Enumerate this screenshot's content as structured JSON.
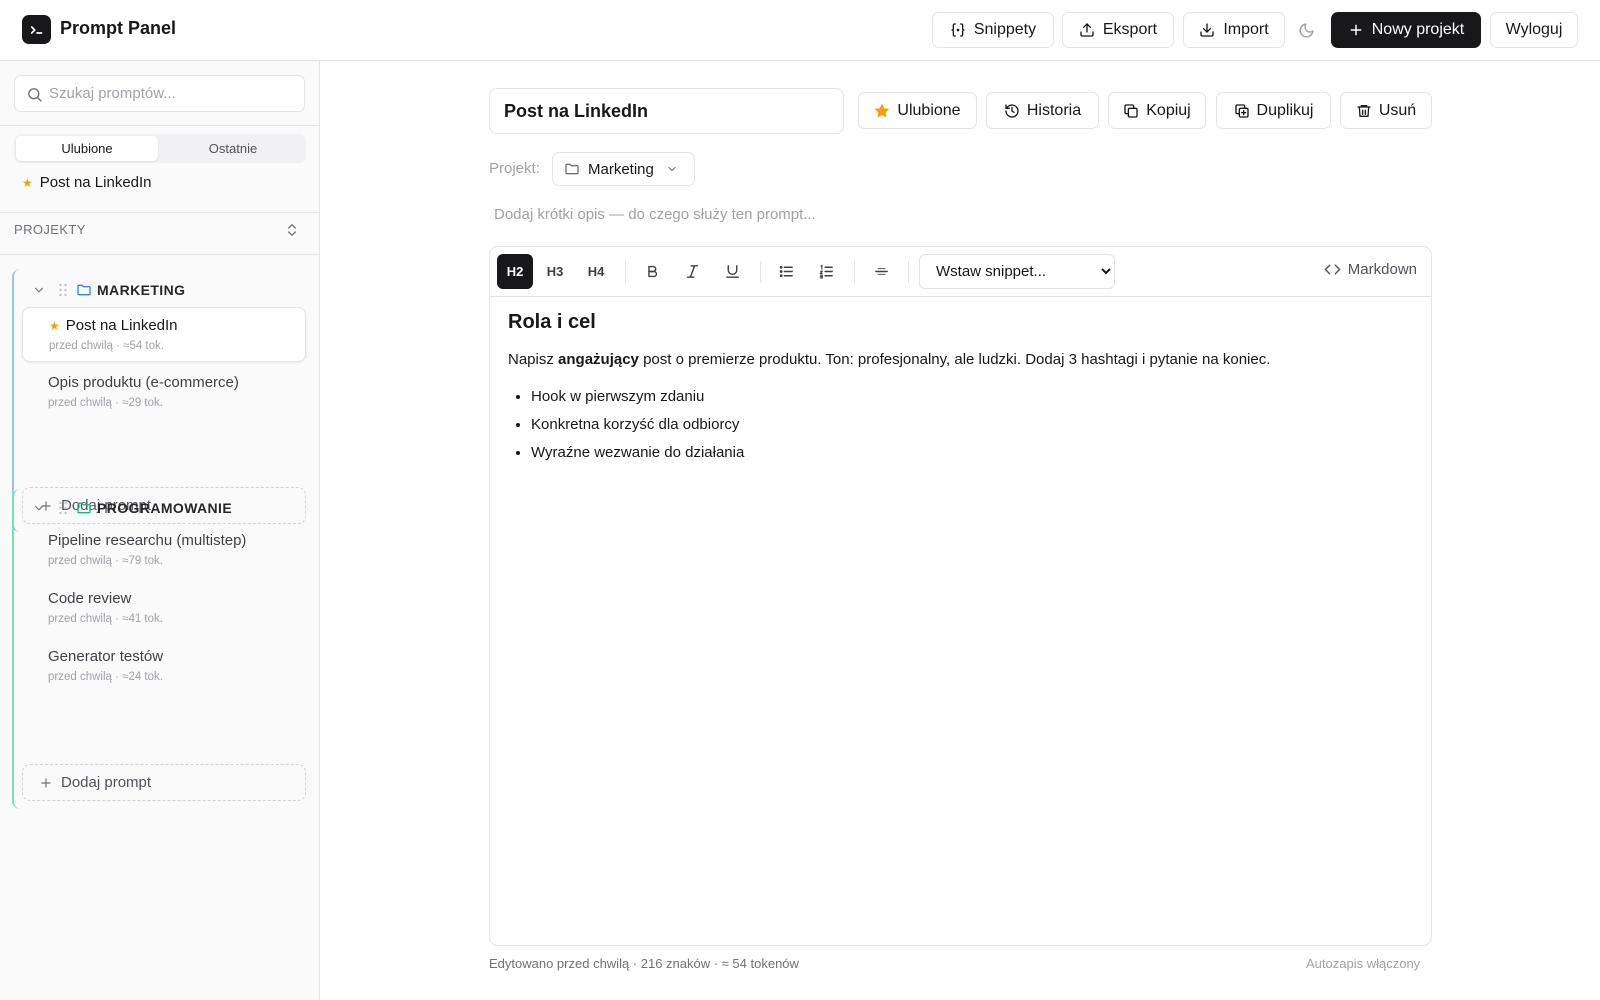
{
  "app": {
    "title": "Prompt Panel"
  },
  "topbar": {
    "snippets": "Snippety",
    "export": "Eksport",
    "import": "Import",
    "theme_icon": "moon-icon",
    "new_project": "Nowy projekt",
    "logout": "Wyloguj"
  },
  "sidebar": {
    "search_placeholder": "Szukaj promptów...",
    "tabs": [
      "Ulubione",
      "Ostatnie"
    ],
    "favorites": [
      {
        "title": "Post na LinkedIn"
      }
    ],
    "projects_heading": "PROJEKTY",
    "groups": [
      {
        "name": "MARKETING",
        "color": "#3b82f6",
        "items": [
          {
            "title": "Post na LinkedIn",
            "meta": "przed chwilą · ≈54 tok.",
            "starred": true,
            "active": true
          },
          {
            "title": "Opis produktu (e-commerce)",
            "meta": "przed chwilą · ≈29 tok.",
            "starred": false,
            "active": false
          }
        ],
        "add_label": "Dodaj prompt"
      },
      {
        "name": "PROGRAMOWANIE",
        "color": "#10b981",
        "items": [
          {
            "title": "Pipeline researchu (multistep)",
            "meta": "przed chwilą · ≈79 tok.",
            "starred": false,
            "active": false
          },
          {
            "title": "Code review",
            "meta": "przed chwilą · ≈41 tok.",
            "starred": false,
            "active": false
          },
          {
            "title": "Generator testów",
            "meta": "przed chwilą · ≈24 tok.",
            "starred": false,
            "active": false
          }
        ],
        "add_label": "Dodaj prompt"
      }
    ]
  },
  "editor": {
    "title_value": "Post na LinkedIn",
    "actions": {
      "favorite": "Ulubione",
      "history": "Historia",
      "copy": "Kopiuj",
      "duplicate": "Duplikuj",
      "delete": "Usuń"
    },
    "project_label": "Projekt:",
    "project_value": "Marketing",
    "description_placeholder": "Dodaj krótki opis — do czego służy ten prompt...",
    "toolbar": {
      "h2": "H2",
      "h3": "H3",
      "h4": "H4",
      "snippet_placeholder": "Wstaw snippet...",
      "markdown": "Markdown"
    },
    "content": {
      "heading": "Rola i cel",
      "paragraph_before": "Napisz ",
      "paragraph_bold": "angażujący",
      "paragraph_after": " post o premierze produktu. Ton: profesjonalny, ale ludzki. Dodaj 3 hashtagi i pytanie na koniec.",
      "bullets": [
        "Hook w pierwszym zdaniu",
        "Konkretna korzyść dla odbiorcy",
        "Wyraźne wezwanie do działania"
      ]
    }
  },
  "status": {
    "left": "Edytowano przed chwilą · 216 znaków · ≈ 54 tokenów",
    "right": "Autozapis włączony"
  },
  "colors": {
    "accent": "#18181b",
    "star": "#f59e0b",
    "marketing": "#3b82f6",
    "programming": "#10b981"
  }
}
